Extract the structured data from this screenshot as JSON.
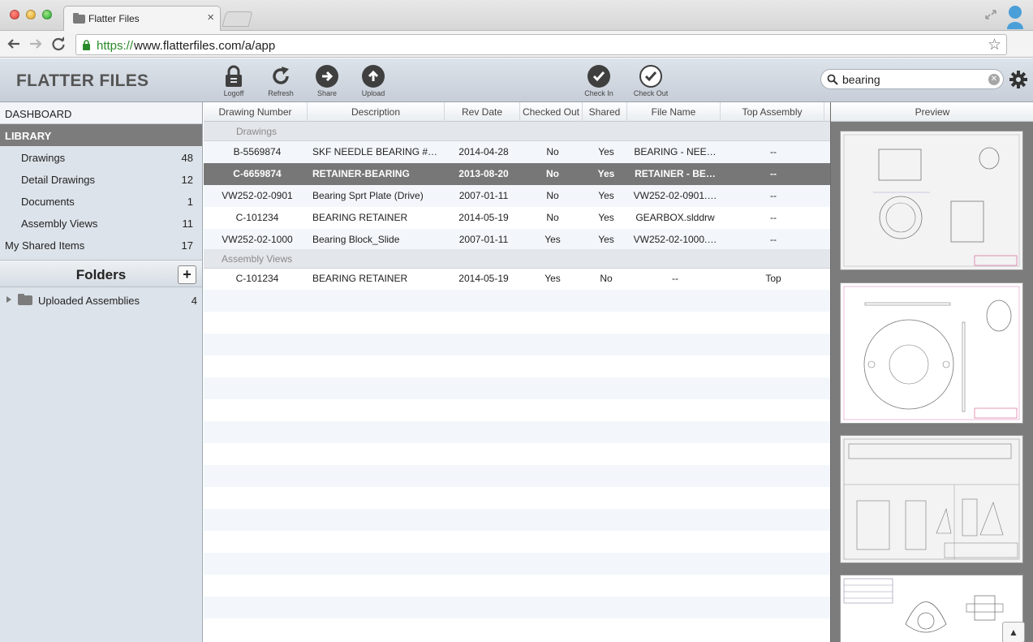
{
  "browser": {
    "tab_title": "Flatter Files",
    "tab_close": "×",
    "url_scheme": "https://",
    "url_rest": "www.flatterfiles.com/a/app"
  },
  "header": {
    "brand": "FLATTER FILES",
    "tools": [
      {
        "label": "Logoff",
        "icon": "lock-icon"
      },
      {
        "label": "Refresh",
        "icon": "refresh-icon"
      },
      {
        "label": "Share",
        "icon": "arrow-right-icon"
      },
      {
        "label": "Upload",
        "icon": "arrow-up-icon"
      },
      {
        "label": "Check In",
        "icon": "checkmark-icon"
      },
      {
        "label": "Check Out",
        "icon": "checkmark-icon"
      }
    ],
    "search_value": "bearing"
  },
  "sidebar": {
    "dashboard": "DASHBOARD",
    "library": "LIBRARY",
    "items": [
      {
        "label": "Drawings",
        "count": "48"
      },
      {
        "label": "Detail Drawings",
        "count": "12"
      },
      {
        "label": "Documents",
        "count": "1"
      },
      {
        "label": "Assembly Views",
        "count": "11"
      }
    ],
    "shared": {
      "label": "My Shared Items",
      "count": "17"
    },
    "folders_title": "Folders",
    "add_folder": "+",
    "folder": {
      "label": "Uploaded Assemblies",
      "count": "4"
    }
  },
  "table": {
    "columns": [
      "Drawing Number",
      "Description",
      "Rev Date",
      "Checked Out",
      "Shared",
      "File Name",
      "Top Assembly"
    ],
    "group_drawings": "Drawings",
    "group_assembly": "Assembly Views",
    "drawings": [
      {
        "number": "B-5569874",
        "description": "SKF NEEDLE BEARING #…",
        "rev_date": "2014-04-28",
        "checked_out": "No",
        "shared": "Yes",
        "file_name": "BEARING - NEE…",
        "top": "--"
      },
      {
        "number": "C-6659874",
        "description": "RETAINER-BEARING",
        "rev_date": "2013-08-20",
        "checked_out": "No",
        "shared": "Yes",
        "file_name": "RETAINER - BE…",
        "top": "--"
      },
      {
        "number": "VW252-02-0901",
        "description": "Bearing Sprt  Plate (Drive)",
        "rev_date": "2007-01-11",
        "checked_out": "No",
        "shared": "Yes",
        "file_name": "VW252-02-0901.…",
        "top": "--"
      },
      {
        "number": "C-101234",
        "description": "BEARING RETAINER",
        "rev_date": "2014-05-19",
        "checked_out": "No",
        "shared": "Yes",
        "file_name": "GEARBOX.slddrw",
        "top": "--"
      },
      {
        "number": "VW252-02-1000",
        "description": "Bearing Block_Slide",
        "rev_date": "2007-01-11",
        "checked_out": "Yes",
        "shared": "Yes",
        "file_name": "VW252-02-1000.…",
        "top": "--"
      }
    ],
    "assembly": [
      {
        "number": "C-101234",
        "description": "BEARING RETAINER",
        "rev_date": "2014-05-19",
        "checked_out": "Yes",
        "shared": "No",
        "file_name": "--",
        "top": "Top"
      }
    ]
  },
  "preview": {
    "title": "Preview",
    "scroll_top": "▲"
  },
  "colors": {
    "selected_row": "#777777",
    "library_bg": "#7c7c7c",
    "sidebar_bg": "#dde3ea",
    "url_green": "#2a8a2a"
  }
}
